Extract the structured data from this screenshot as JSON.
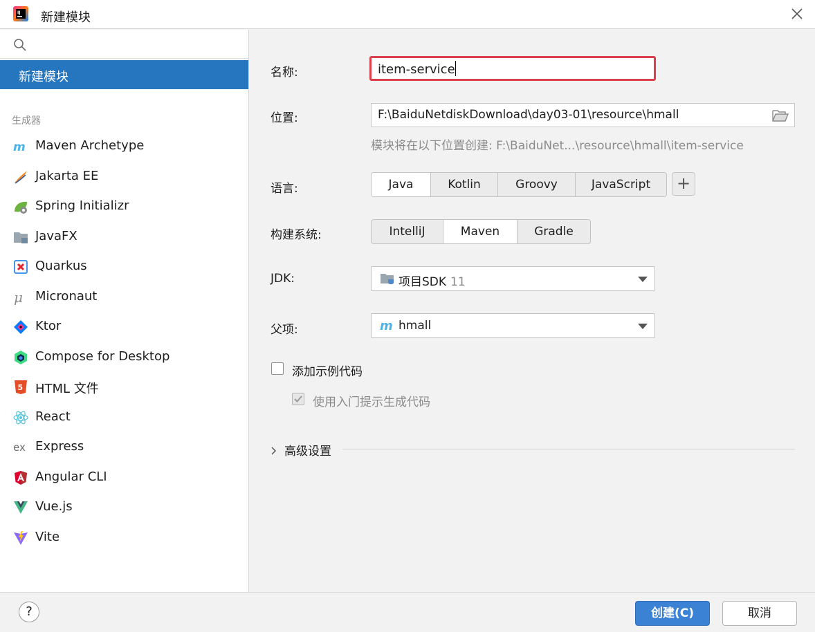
{
  "window": {
    "title": "新建模块"
  },
  "sidebar": {
    "search_placeholder": "",
    "selected": "新建模块",
    "group_label": "生成器",
    "generators": [
      {
        "label": "Maven Archetype",
        "icon": "maven-icon"
      },
      {
        "label": "Jakarta EE",
        "icon": "jakarta-ee-icon"
      },
      {
        "label": "Spring Initializr",
        "icon": "spring-icon"
      },
      {
        "label": "JavaFX",
        "icon": "javafx-icon"
      },
      {
        "label": "Quarkus",
        "icon": "quarkus-icon"
      },
      {
        "label": "Micronaut",
        "icon": "micronaut-icon"
      },
      {
        "label": "Ktor",
        "icon": "ktor-icon"
      },
      {
        "label": "Compose for Desktop",
        "icon": "compose-icon"
      },
      {
        "label": "HTML 文件",
        "icon": "html5-icon"
      },
      {
        "label": "React",
        "icon": "react-icon"
      },
      {
        "label": "Express",
        "icon": "express-icon"
      },
      {
        "label": "Angular CLI",
        "icon": "angular-icon"
      },
      {
        "label": "Vue.js",
        "icon": "vue-icon"
      },
      {
        "label": "Vite",
        "icon": "vite-icon"
      }
    ]
  },
  "form": {
    "name_label": "名称:",
    "name_value": "item-service",
    "location_label": "位置:",
    "location_value": "F:\\BaiduNetdiskDownload\\day03-01\\resource\\hmall",
    "location_hint": "模块将在以下位置创建: F:\\BaiduNet...\\resource\\hmall\\item-service",
    "language_label": "语言:",
    "languages": [
      "Java",
      "Kotlin",
      "Groovy",
      "JavaScript"
    ],
    "language_selected": "Java",
    "build_label": "构建系统:",
    "build_systems": [
      "IntelliJ",
      "Maven",
      "Gradle"
    ],
    "build_selected": "Maven",
    "jdk_label": "JDK:",
    "jdk_value": "项目SDK",
    "jdk_version": "11",
    "parent_label": "父项:",
    "parent_value": "hmall",
    "sample_code_label": "添加示例代码",
    "sample_code_checked": false,
    "onboarding_label": "使用入门提示生成代码",
    "onboarding_checked": true,
    "advanced_label": "高级设置"
  },
  "footer": {
    "help_label": "?",
    "create_label": "创建(C)",
    "cancel_label": "取消"
  },
  "colors": {
    "accent": "#2675bf",
    "highlight_border": "#d9404b",
    "primary_button": "#3b82d4"
  }
}
